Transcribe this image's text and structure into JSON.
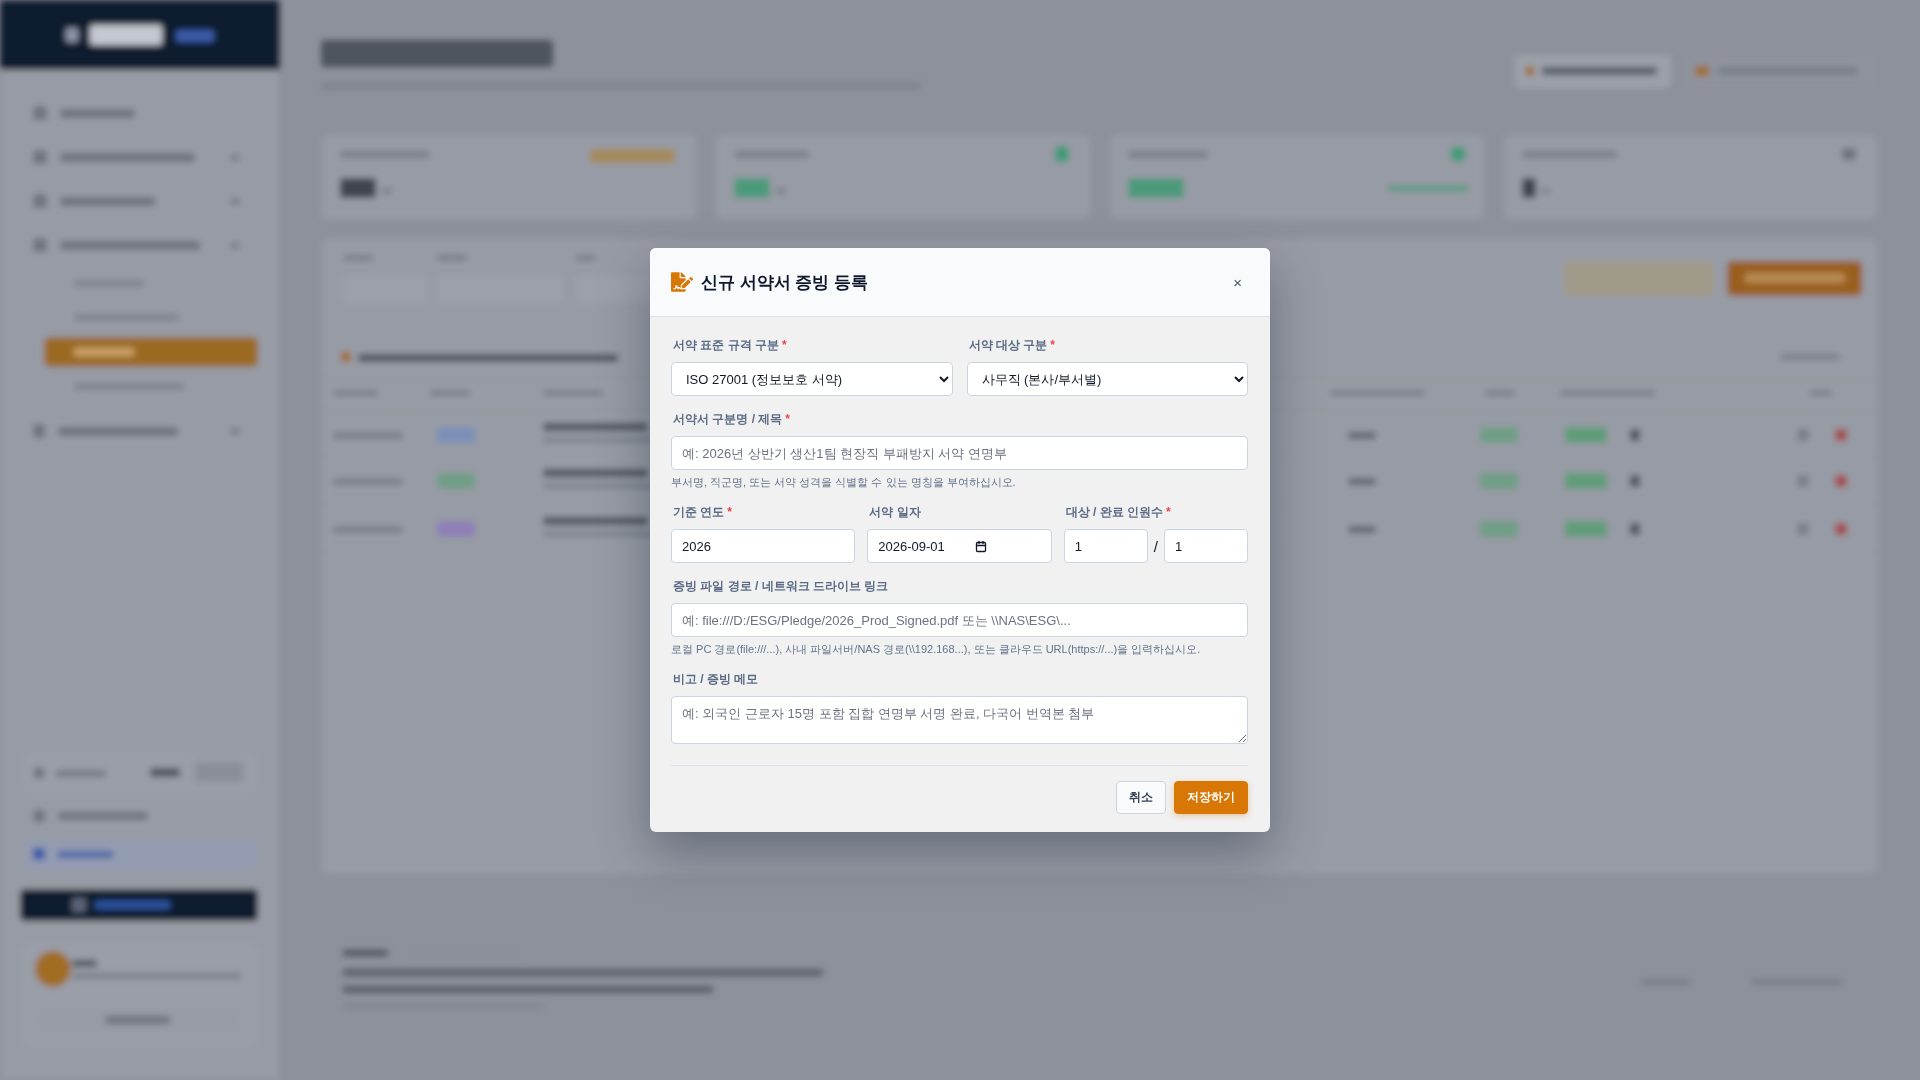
{
  "dialog": {
    "title": "신규 서약서 증빙 등록",
    "close_label": "×",
    "rows": [
      {
        "fields": [
          {
            "kind": "select",
            "label": "서약 표준 규격 구분",
            "required_mark": "*",
            "value": "ISO 27001 (정보보호 서약)"
          },
          {
            "kind": "select",
            "label": "서약 대상 구분",
            "required_mark": "*",
            "value": "사무직 (본사/부서별)"
          }
        ]
      },
      {
        "fields": [
          {
            "kind": "text",
            "label": "서약서 구분명 / 제목",
            "required_mark": "*",
            "placeholder": "예: 2026년 상반기 생산1팀 현장직 부패방지 서약 연명부",
            "hint": "부서명, 직군명, 또는 서약 성격을 식별할 수 있는 명칭을 부여하십시오."
          }
        ]
      },
      {
        "fields": [
          {
            "kind": "text",
            "label": "기준 연도",
            "required_mark": "*",
            "value": "2026"
          },
          {
            "kind": "date",
            "label": "서약 일자",
            "value": "2026-09-01"
          },
          {
            "kind": "pair",
            "label": "대상 / 완료 인원수",
            "required_mark": "*",
            "values": [
              "1",
              "1"
            ],
            "separator": "/"
          }
        ]
      },
      {
        "fields": [
          {
            "kind": "text",
            "label": "증빙 파일 경로 / 네트워크 드라이브 링크",
            "placeholder": "예: file:///D:/ESG/Pledge/2026_Prod_Signed.pdf 또는 \\\\NAS\\ESG\\...",
            "hint": "로컬 PC 경로(file:///...), 사내 파일서버/NAS 경로(\\\\192.168...), 또는 클라우드 URL(https://...)을 입력하십시오."
          }
        ]
      },
      {
        "fields": [
          {
            "kind": "textarea",
            "label": "비고 / 증빙 메모",
            "placeholder": "예: 외국인 근로자 15명 포함 집합 연명부 서명 완료, 다국어 번역본 첨부"
          }
        ]
      }
    ],
    "buttons": [
      {
        "kind": "secondary",
        "label": "취소"
      },
      {
        "kind": "primary",
        "label": "저장하기"
      }
    ]
  }
}
